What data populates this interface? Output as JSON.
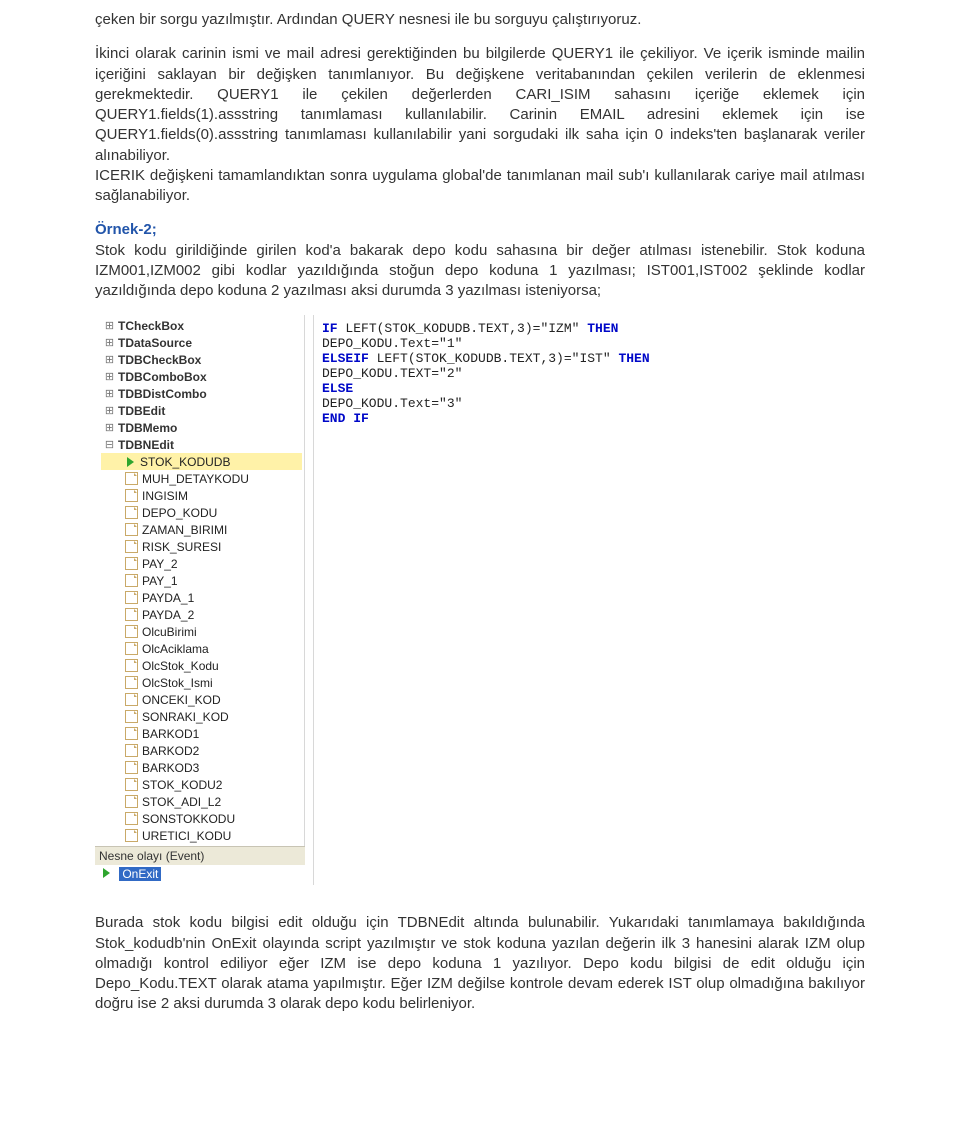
{
  "para1": "çeken bir sorgu yazılmıştır. Ardından QUERY nesnesi ile bu sorguyu çalıştırıyoruz.",
  "para2": "İkinci olarak carinin ismi ve mail adresi gerektiğinden bu bilgilerde QUERY1 ile çekiliyor. Ve içerik isminde mailin içeriğini saklayan bir değişken tanımlanıyor. Bu değişkene veritabanından çekilen verilerin de eklenmesi gerekmektedir. QUERY1 ile çekilen değerlerden CARI_ISIM sahasını içeriğe eklemek için QUERY1.fields(1).assstring tanımlaması kullanılabilir. Carinin EMAIL adresini eklemek için ise QUERY1.fields(0).assstring tanımlaması kullanılabilir yani sorgudaki ilk saha için 0 indeks'ten başlanarak veriler alınabiliyor.",
  "para3": "ICERIK değişkeni tamamlandıktan sonra uygulama global'de tanımlanan mail sub'ı kullanılarak cariye mail atılması sağlanabiliyor.",
  "example_label": "Örnek-2;",
  "para4": "Stok kodu girildiğinde girilen kod'a bakarak depo kodu sahasına bir değer atılması istenebilir. Stok koduna IZM001,IZM002 gibi kodlar yazıldığında stoğun depo koduna 1 yazılması; IST001,IST002 şeklinde kodlar yazıldığında depo koduna 2 yazılması aksi durumda 3 yazılması isteniyorsa;",
  "tree": {
    "nodes": [
      {
        "t": "TCheckBox"
      },
      {
        "t": "TDataSource"
      },
      {
        "t": "TDBCheckBox"
      },
      {
        "t": "TDBComboBox"
      },
      {
        "t": "TDBDistCombo"
      },
      {
        "t": "TDBEdit"
      },
      {
        "t": "TDBMemo"
      }
    ],
    "expanded": "TDBNEdit",
    "children": [
      "STOK_KODUDB",
      "MUH_DETAYKODU",
      "INGISIM",
      "DEPO_KODU",
      "ZAMAN_BIRIMI",
      "RISK_SURESI",
      "PAY_2",
      "PAY_1",
      "PAYDA_1",
      "PAYDA_2",
      "OlcuBirimi",
      "OlcAciklama",
      "OlcStok_Kodu",
      "OlcStok_Ismi",
      "ONCEKI_KOD",
      "SONRAKI_KOD",
      "BARKOD1",
      "BARKOD2",
      "BARKOD3",
      "STOK_KODU2",
      "STOK_ADI_L2",
      "SONSTOKKODU",
      "URETICI_KODU"
    ],
    "selected_child_index": 0,
    "event_label": "Nesne olayı (Event)",
    "event_selected": "OnExit"
  },
  "code": {
    "l1a": "IF",
    "l1b": " LEFT(STOK_KODUDB.TEXT,3)=\"IZM\" ",
    "l1c": "THEN",
    "l2": "DEPO_KODU.Text=\"1\"",
    "l3a": "ELSEIF",
    "l3b": " LEFT(STOK_KODUDB.TEXT,3)=\"IST\" ",
    "l3c": "THEN",
    "l4": "DEPO_KODU.TEXT=\"2\"",
    "l5": "ELSE",
    "l6": "DEPO_KODU.Text=\"3\"",
    "l7": "END IF"
  },
  "para5": "Burada stok kodu bilgisi edit olduğu için TDBNEdit altında bulunabilir. Yukarıdaki tanımlamaya bakıldığında Stok_kodudb'nin OnExit olayında script yazılmıştır ve stok koduna yazılan değerin ilk 3 hanesini alarak IZM olup olmadığı kontrol ediliyor eğer IZM ise depo koduna 1 yazılıyor. Depo kodu bilgisi de edit olduğu için Depo_Kodu.TEXT olarak atama yapılmıştır. Eğer IZM değilse kontrole devam ederek IST olup olmadığına bakılıyor doğru ise 2 aksi durumda 3 olarak depo kodu belirleniyor."
}
